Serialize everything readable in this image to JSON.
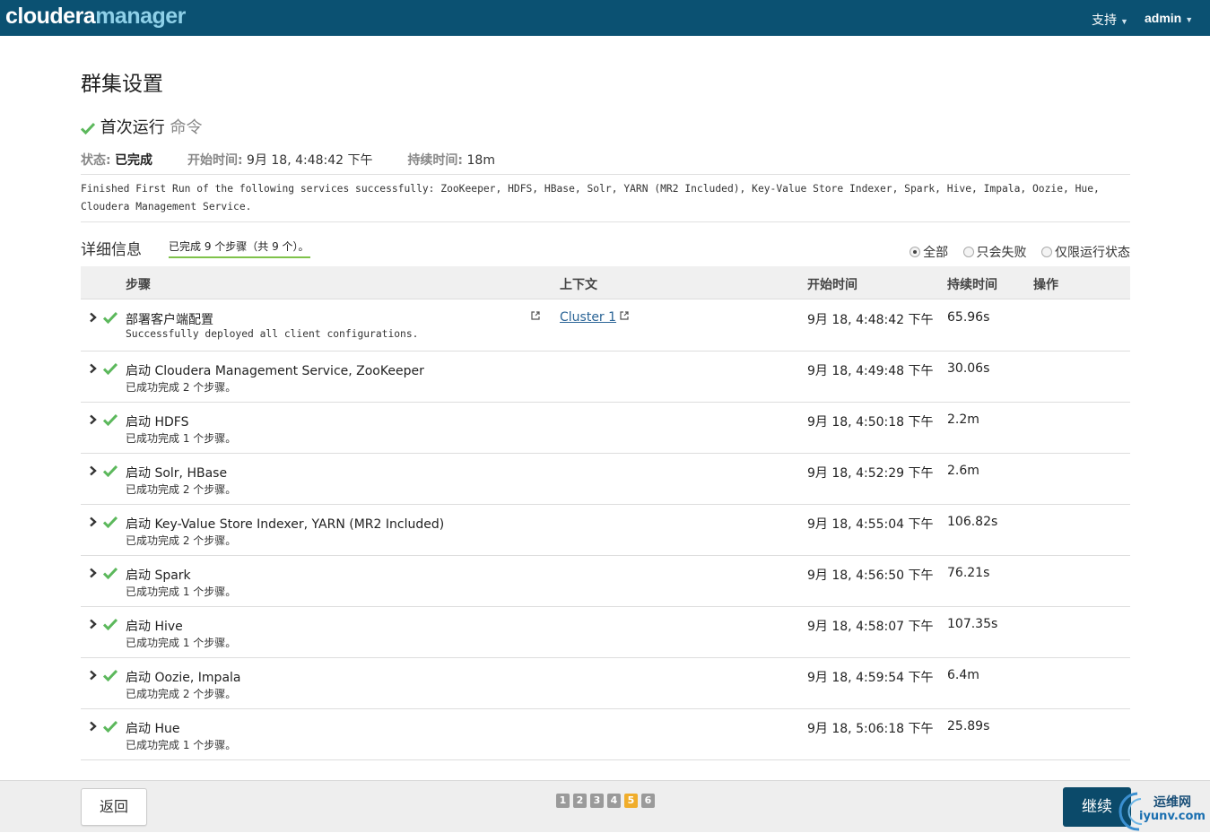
{
  "header": {
    "logo_part1": "cloudera",
    "logo_part2": "manager",
    "support_label": "支持",
    "user_label": "admin"
  },
  "page": {
    "title": "群集设置",
    "command_title": "首次运行",
    "command_suffix": "命令",
    "status_label": "状态:",
    "status_value": "已完成",
    "start_label": "开始时间:",
    "start_value": "9月 18, 4:48:42 下午",
    "duration_label": "持续时间:",
    "duration_value": "18m",
    "summary": "Finished First Run of the following services successfully: ZooKeeper, HDFS, HBase, Solr, YARN (MR2 Included), Key-Value Store Indexer, Spark, Hive, Impala, Oozie, Hue, Cloudera Management Service."
  },
  "details": {
    "title": "详细信息",
    "progress_text": "已完成 9 个步骤（共 9 个）。",
    "filters": [
      "全部",
      "只会失败",
      "仅限运行状态"
    ],
    "selected_filter": "全部"
  },
  "table": {
    "columns": [
      "步骤",
      "上下文",
      "开始时间",
      "持续时间",
      "操作"
    ],
    "rows": [
      {
        "step": "部署客户端配置",
        "sub": "Successfully deployed all client configurations.",
        "context": "Cluster 1",
        "start": "9月 18, 4:48:42 下午",
        "duration": "65.96s"
      },
      {
        "step": "启动 Cloudera Management Service, ZooKeeper",
        "sub": "已成功完成 2 个步骤。",
        "context": "",
        "start": "9月 18, 4:49:48 下午",
        "duration": "30.06s"
      },
      {
        "step": "启动 HDFS",
        "sub": "已成功完成 1 个步骤。",
        "context": "",
        "start": "9月 18, 4:50:18 下午",
        "duration": "2.2m"
      },
      {
        "step": "启动 Solr, HBase",
        "sub": "已成功完成 2 个步骤。",
        "context": "",
        "start": "9月 18, 4:52:29 下午",
        "duration": "2.6m"
      },
      {
        "step": "启动 Key-Value Store Indexer, YARN (MR2 Included)",
        "sub": "已成功完成 2 个步骤。",
        "context": "",
        "start": "9月 18, 4:55:04 下午",
        "duration": "106.82s"
      },
      {
        "step": "启动 Spark",
        "sub": "已成功完成 1 个步骤。",
        "context": "",
        "start": "9月 18, 4:56:50 下午",
        "duration": "76.21s"
      },
      {
        "step": "启动 Hive",
        "sub": "已成功完成 1 个步骤。",
        "context": "",
        "start": "9月 18, 4:58:07 下午",
        "duration": "107.35s"
      },
      {
        "step": "启动 Oozie, Impala",
        "sub": "已成功完成 2 个步骤。",
        "context": "",
        "start": "9月 18, 4:59:54 下午",
        "duration": "6.4m"
      },
      {
        "step": "启动 Hue",
        "sub": "已成功完成 1 个步骤。",
        "context": "",
        "start": "9月 18, 5:06:18 下午",
        "duration": "25.89s"
      }
    ]
  },
  "footer": {
    "back_label": "返回",
    "next_label": "继续",
    "pages": [
      "1",
      "2",
      "3",
      "4",
      "5",
      "6"
    ],
    "active_page": "5"
  },
  "watermark": {
    "line1": "运维网",
    "line2": "iyunv.com"
  },
  "colors": {
    "topbar": "#0b5172",
    "success_check": "#5cb85c",
    "progress_underline": "#7fc24a",
    "active_page": "#f0ad2b",
    "primary_button": "#0b4a6a"
  },
  "icons": {
    "success": "check-icon",
    "expand": "chevron-right-icon",
    "external": "external-link-icon",
    "dropdown": "caret-down-icon"
  }
}
